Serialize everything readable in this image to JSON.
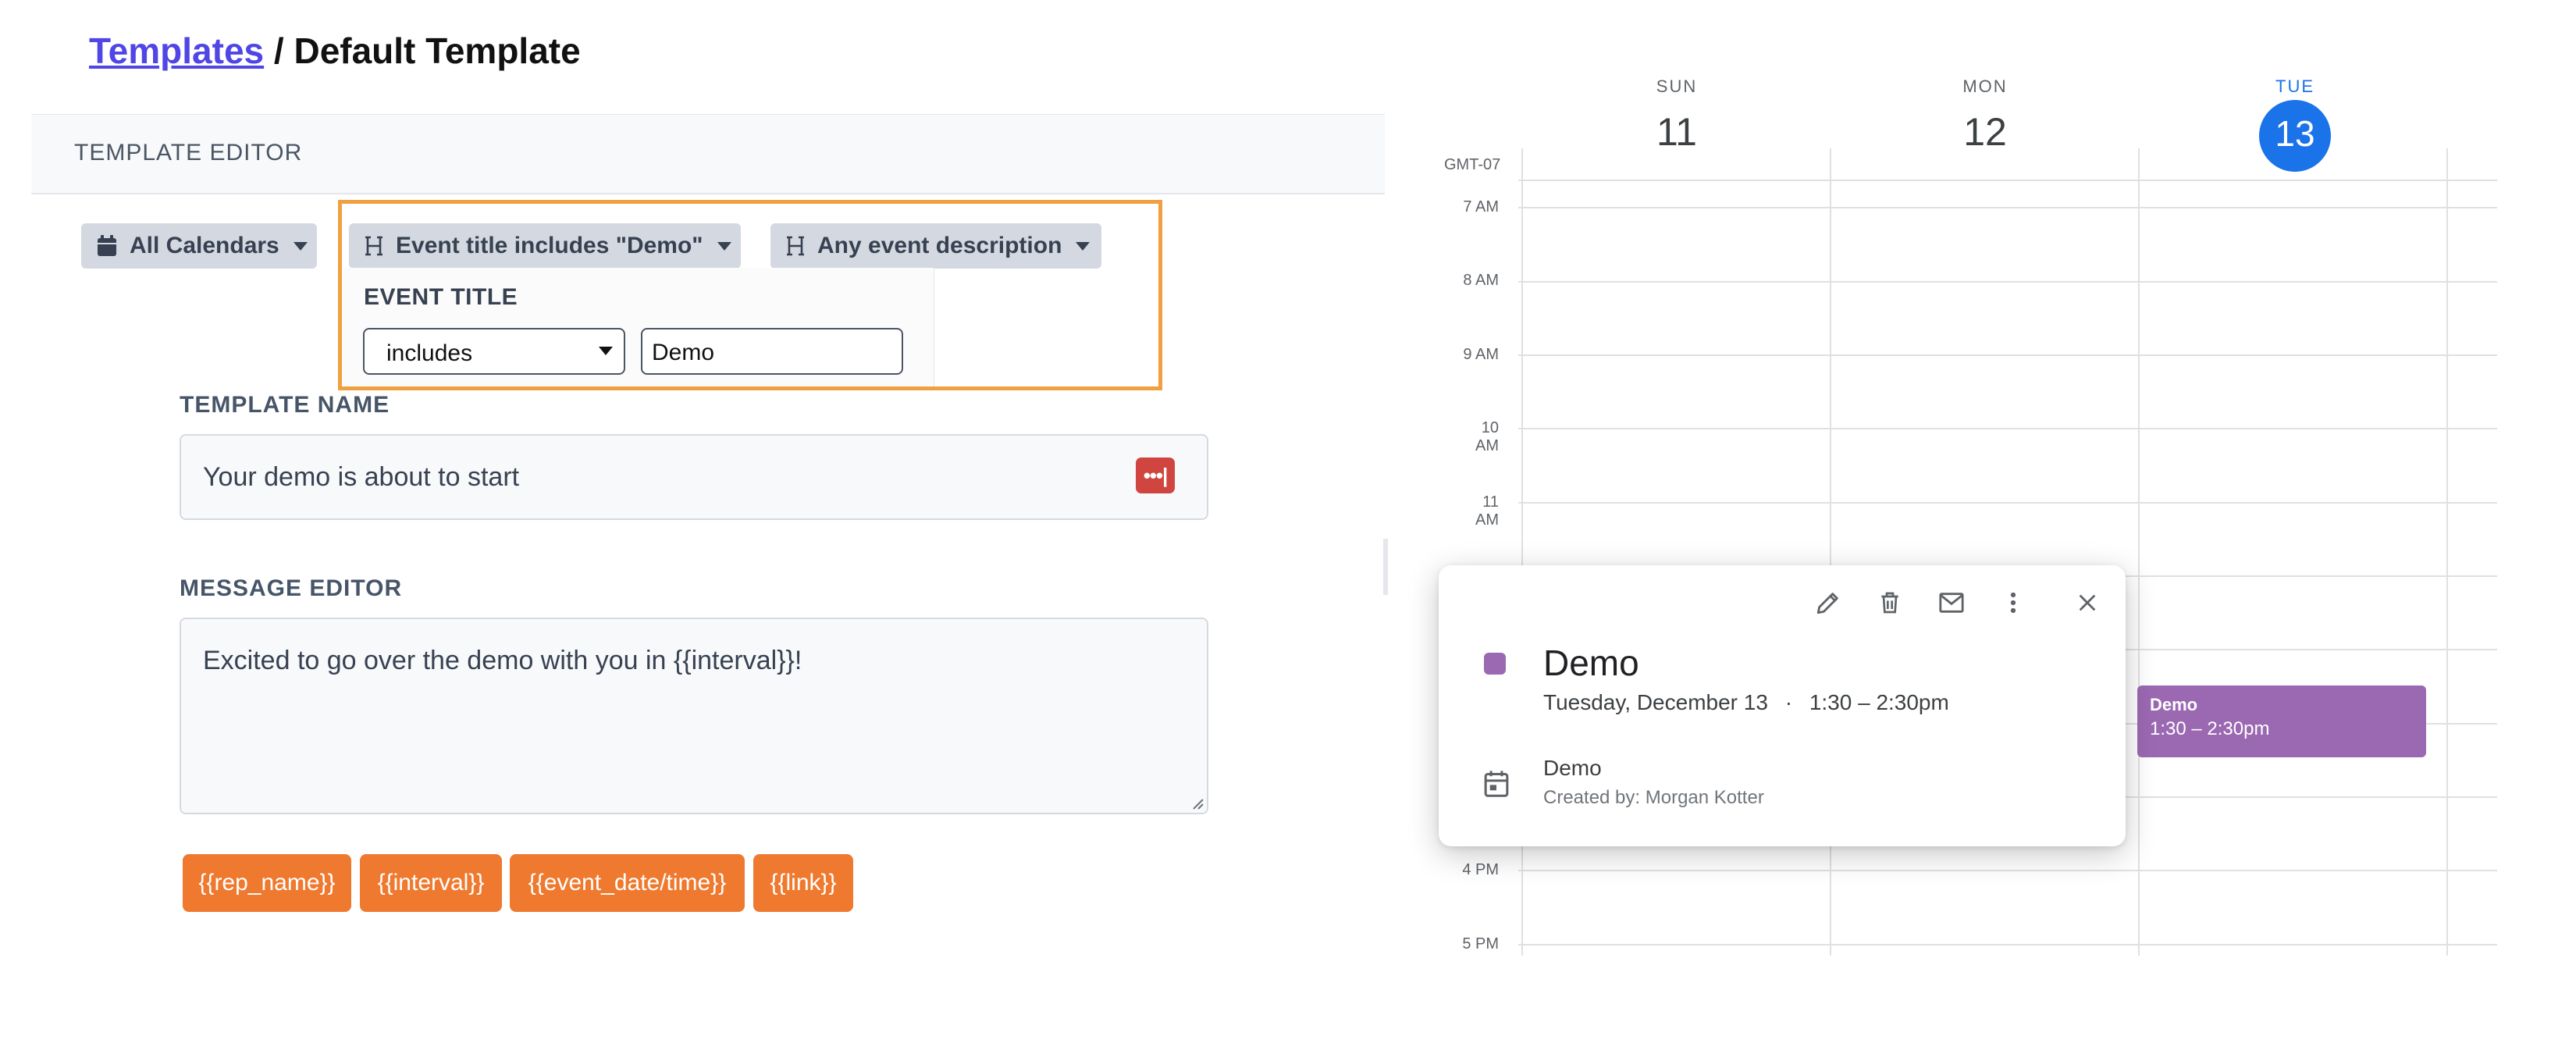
{
  "breadcrumb": {
    "parent": "Templates",
    "separator": " / ",
    "current": "Default Template"
  },
  "editor": {
    "header": "TEMPLATE EDITOR",
    "filters": {
      "calendar": "All Calendars",
      "title": "Event title includes \"Demo\"",
      "description": "Any event description"
    },
    "event_title_panel": {
      "label": "EVENT TITLE",
      "operator": "includes",
      "value": "Demo"
    },
    "template_name": {
      "label": "TEMPLATE NAME",
      "value": "Your demo is about to start",
      "icon": "password-manager-icon"
    },
    "message_editor": {
      "label": "MESSAGE EDITOR",
      "value": "Excited to go over the demo with you in {{interval}}!"
    },
    "tags": [
      "{{rep_name}}",
      "{{interval}}",
      "{{event_date/time}}",
      "{{link}}"
    ],
    "accent_color": "#ef7a2f",
    "highlight_color": "#f0a040"
  },
  "calendar": {
    "timezone": "GMT-07",
    "days": [
      {
        "name": "SUN",
        "num": "11"
      },
      {
        "name": "MON",
        "num": "12"
      },
      {
        "name": "TUE",
        "num": "13",
        "today": true
      }
    ],
    "hours": [
      "7 AM",
      "8 AM",
      "9 AM",
      "10 AM",
      "11 AM",
      "4 PM",
      "5 PM"
    ],
    "today_color": "#1a73e8",
    "event": {
      "title": "Demo",
      "time": "1:30 – 2:30pm",
      "color": "#9b69b2"
    },
    "popup": {
      "title": "Demo",
      "date": "Tuesday, December 13",
      "separator": "·",
      "time": "1:30 – 2:30pm",
      "calendar_name": "Demo",
      "created_by": "Created by: Morgan Kotter",
      "actions": [
        "edit-icon",
        "delete-icon",
        "email-icon",
        "more-options-icon",
        "close-icon"
      ]
    }
  }
}
